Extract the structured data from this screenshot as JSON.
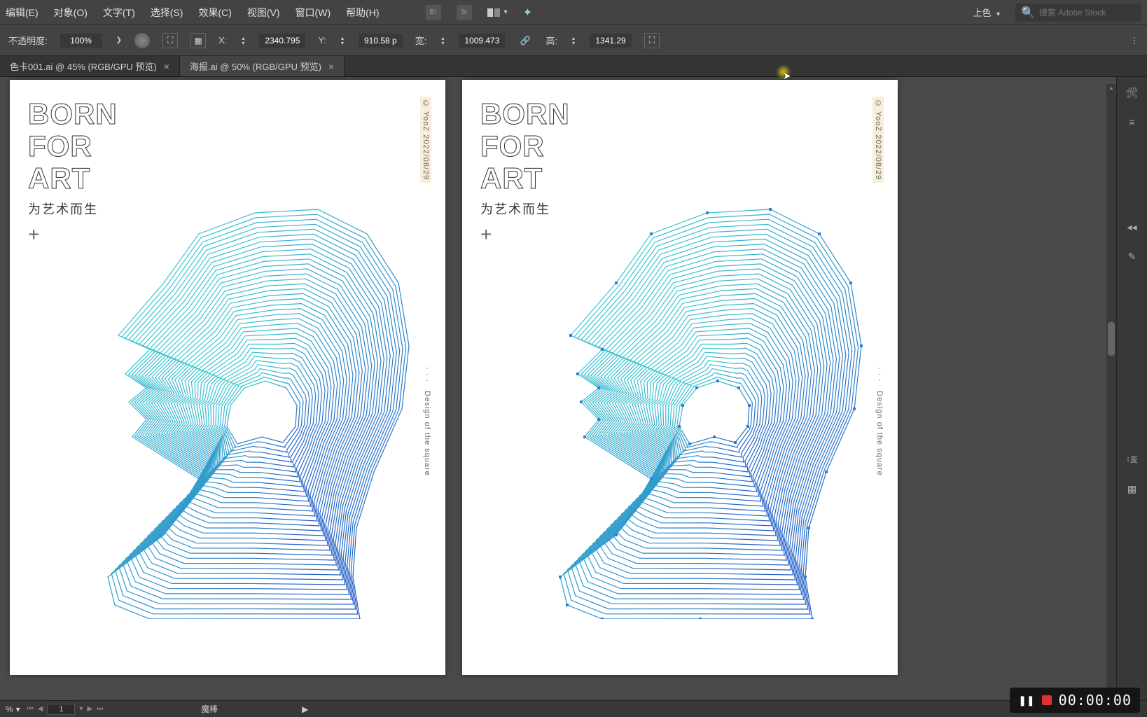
{
  "menubar": {
    "items": [
      "编辑(E)",
      "对象(O)",
      "文字(T)",
      "选择(S)",
      "效果(C)",
      "视图(V)",
      "窗口(W)",
      "帮助(H)"
    ],
    "color_mode": "上色",
    "search_placeholder": "搜索 Adobe Stock"
  },
  "optionsbar": {
    "opacity_label": "不透明度:",
    "opacity_value": "100%",
    "x_label": "X:",
    "x_value": "2340.795",
    "y_label": "Y:",
    "y_value": "910.58 p",
    "w_label": "宽:",
    "w_value": "1009.473",
    "h_label": "高:",
    "h_value": "1341.29 "
  },
  "tabs": [
    {
      "label": "色卡001.ai @ 45% (RGB/GPU 预览)",
      "active": false
    },
    {
      "label": "海报.ai @ 50% (RGB/GPU 预览)",
      "active": true
    }
  ],
  "poster": {
    "title_line1": "BORN",
    "title_line2": "FOR",
    "title_line3": "ART",
    "subtitle": "为艺术而生",
    "plus": "+",
    "side_top": "© YooZ   2022/08/29",
    "side_dots": "· · ·",
    "side_bottom": "Design of the square"
  },
  "statusbar": {
    "zoom": "%",
    "page": "1",
    "tool_hint": "魔棒"
  },
  "right_panel": {
    "label_transform": "变"
  },
  "recorder": {
    "time": "00:00:00"
  }
}
